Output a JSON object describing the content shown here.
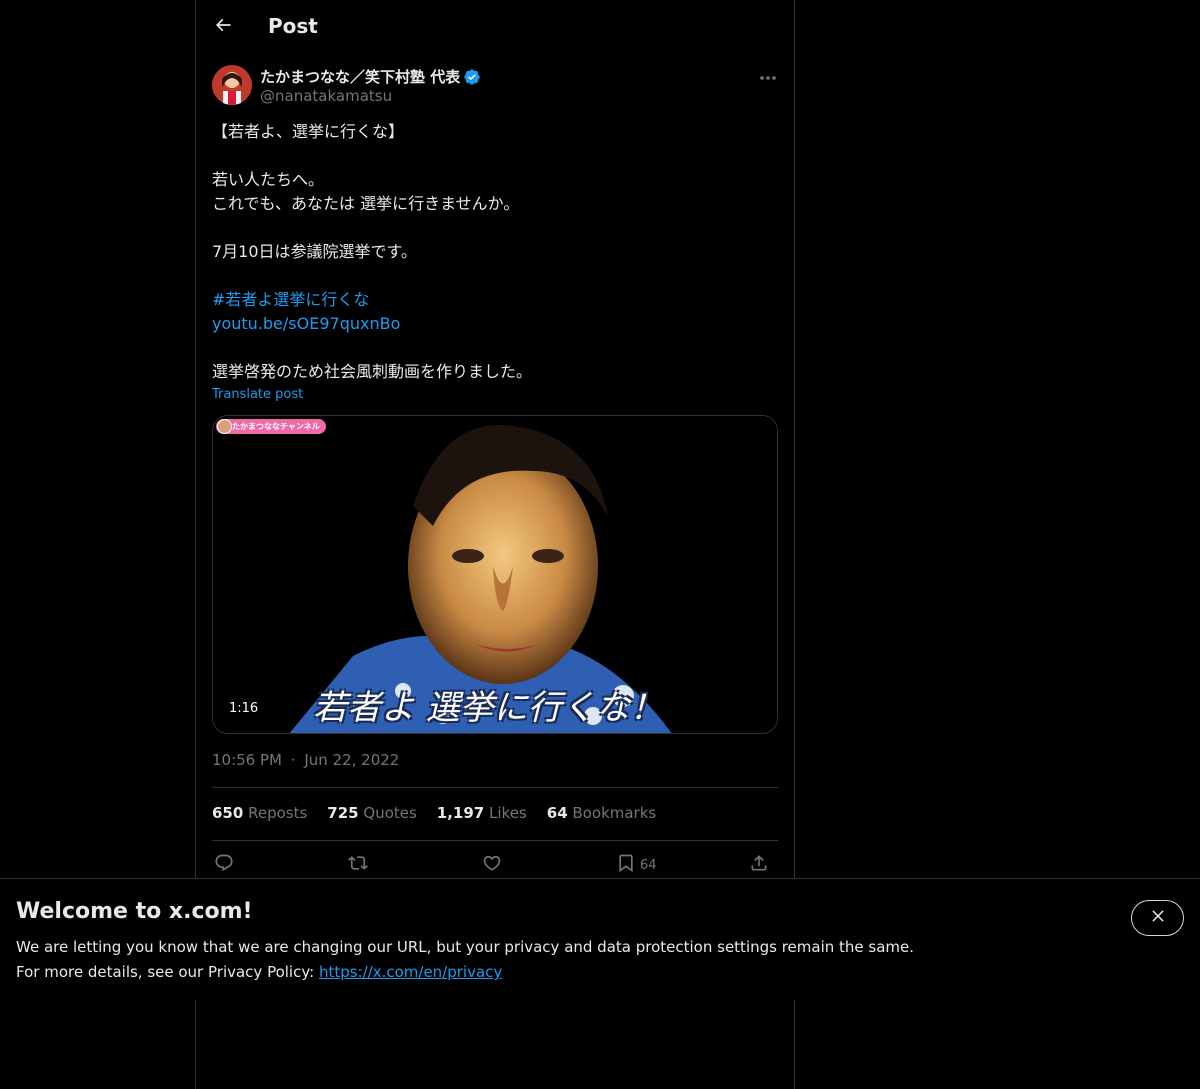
{
  "header": {
    "title": "Post",
    "back_icon": "arrow-left-icon"
  },
  "author": {
    "name": "たかまつなな／笑下村塾 代表",
    "handle": "@nanatakamatsu",
    "verified_icon": "verified-badge-icon",
    "verified_color": "#1d9bf0"
  },
  "post": {
    "lines": [
      "【若者よ、選挙に行くな】",
      "若い人たちへ。",
      "これでも、あなたは 選挙に行きませんか。",
      "7月10日は参議院選挙です。",
      "選挙啓発のため社会風刺動画を作りました。"
    ],
    "hashtag": "#若者よ選挙に行くな",
    "link": "youtu.be/sOE97quxnBo",
    "translate": "Translate post"
  },
  "media": {
    "channel_badge": "たかまつななチャンネル",
    "duration": "1:16",
    "caption": "若者よ 選挙に行くな！"
  },
  "timestamp": {
    "time": "10:56 PM",
    "separator": "·",
    "date": "Jun 22, 2022"
  },
  "stats": {
    "reposts": {
      "count": "650",
      "label": "Reposts"
    },
    "quotes": {
      "count": "725",
      "label": "Quotes"
    },
    "likes": {
      "count": "1,197",
      "label": "Likes"
    },
    "bookmarks": {
      "count": "64",
      "label": "Bookmarks"
    }
  },
  "actions": {
    "reply_icon": "reply-icon",
    "repost_icon": "repost-icon",
    "like_icon": "heart-icon",
    "bookmark_icon": "bookmark-icon",
    "bookmark_count": "64",
    "share_icon": "share-icon"
  },
  "banner": {
    "title": "Welcome to x.com!",
    "line1": "We are letting you know that we are changing our URL, but your privacy and data protection settings remain the same.",
    "line2_prefix": "For more details, see our Privacy Policy: ",
    "privacy_link": "https://x.com/en/privacy",
    "close_icon": "close-icon"
  },
  "colors": {
    "accent": "#1d9bf0",
    "background": "#000000",
    "muted": "#71767b",
    "badge_pink": "#f06aa7"
  }
}
